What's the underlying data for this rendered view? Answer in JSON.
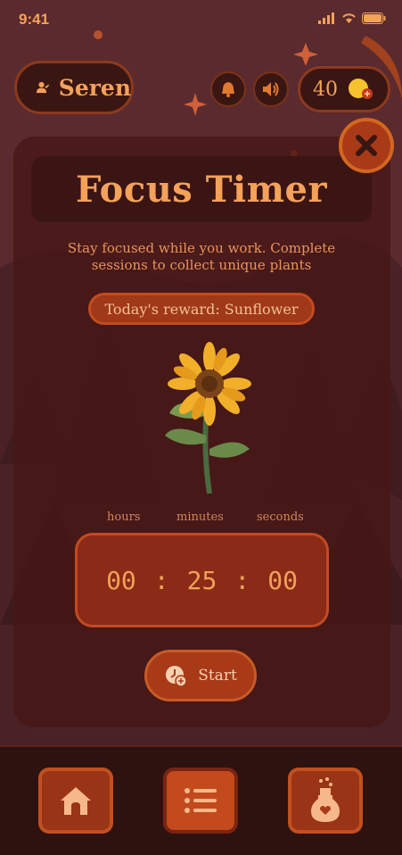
{
  "status_bar": {
    "time": "9:41"
  },
  "user": {
    "name": "Seren"
  },
  "coins": {
    "value": "40"
  },
  "main": {
    "title": "Focus Timer",
    "subtitle": "Stay focused while you work. Complete sessions to collect unique plants",
    "reward": "Today's reward: Sunflower",
    "plant": "sunflower",
    "labels": {
      "hours": "hours",
      "minutes": "minutes",
      "seconds": "seconds"
    },
    "timer": {
      "hours": "00",
      "minutes": "25",
      "seconds": "00",
      "separator": ":"
    },
    "start_label": "Start"
  },
  "nav": [
    {
      "icon": "home-icon"
    },
    {
      "icon": "list-icon"
    },
    {
      "icon": "potion-icon"
    }
  ],
  "colors": {
    "accent": "#f4a25a",
    "background": "#5a2a2e",
    "button": "#a83a18"
  }
}
